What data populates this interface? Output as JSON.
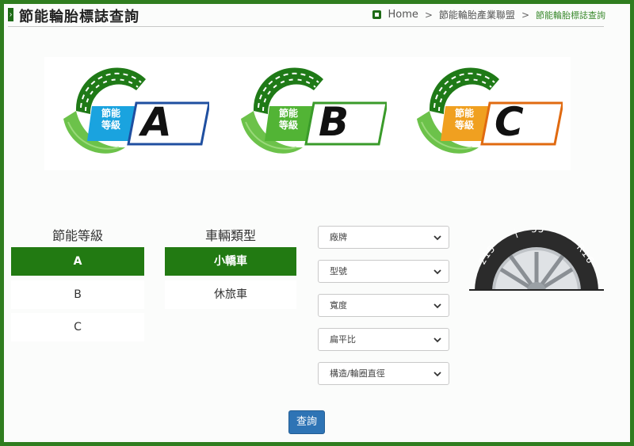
{
  "header": {
    "title": "節能輪胎標誌查詢",
    "breadcrumb": {
      "home": "Home",
      "sep": ">",
      "level1": "節能輪胎產業聯盟",
      "current": "節能輪胎標誌查詢"
    }
  },
  "colors": {
    "frame": "#2f7d1f",
    "active_green": "#227a12",
    "query_blue": "#2e74b5"
  },
  "banner": {
    "badges": [
      {
        "label_line1": "節能",
        "label_line2": "等級",
        "grade": "A",
        "label_color": "#1aa3df"
      },
      {
        "label_line1": "節能",
        "label_line2": "等級",
        "grade": "B",
        "label_color": "#52b435"
      },
      {
        "label_line1": "節能",
        "label_line2": "等級",
        "grade": "C",
        "label_color": "#f0a020"
      }
    ]
  },
  "grade_filter": {
    "title": "節能等級",
    "options": [
      "A",
      "B",
      "C"
    ],
    "selected": "A"
  },
  "vehicle_filter": {
    "title": "車輛類型",
    "options": [
      "小轎車",
      "休旅車"
    ],
    "selected": "小轎車"
  },
  "selects": [
    {
      "placeholder": "廠牌"
    },
    {
      "placeholder": "型號"
    },
    {
      "placeholder": "寬度"
    },
    {
      "placeholder": "扁平比"
    },
    {
      "placeholder": "構造/輪圈直徑"
    }
  ],
  "tire_illustration": {
    "width_text": "215",
    "sep_text": "|",
    "ratio_text": "55",
    "rim_text": "R16"
  },
  "query_button": "查詢"
}
